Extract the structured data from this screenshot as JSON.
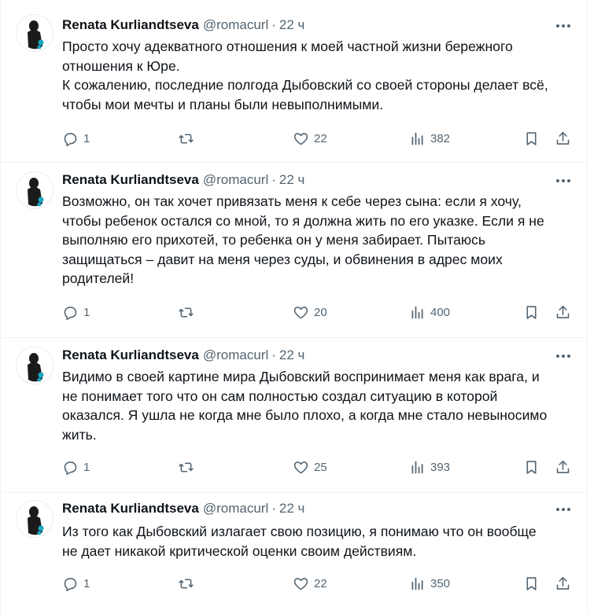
{
  "tweets": [
    {
      "author_name": "Renata Kurliandtseva",
      "handle": "@romacurl",
      "separator": "·",
      "time": "22 ч",
      "lines": [
        "Просто хочу адекватного отношения к моей частной жизни бережного",
        "отношения к Юре.",
        "К сожалению, последние полгода Дыбовский со своей стороны делает всё,",
        "чтобы мои мечты и планы были невыполнимыми."
      ],
      "replies": "1",
      "retweets": "",
      "likes": "22",
      "views": "382"
    },
    {
      "author_name": "Renata Kurliandtseva",
      "handle": "@romacurl",
      "separator": "·",
      "time": "22 ч",
      "lines": [
        "Возможно, он так хочет привязать меня к себе через сына: если я хочу,",
        "чтобы ребенок остался со мной, то я должна жить по его указке. Если я не",
        "выполняю его прихотей, то  ребенка он у меня забирает. Пытаюсь",
        "защищаться – давит на меня через суды, и обвинения в адрес моих",
        "родителей!"
      ],
      "replies": "1",
      "retweets": "",
      "likes": "20",
      "views": "400"
    },
    {
      "author_name": "Renata Kurliandtseva",
      "handle": "@romacurl",
      "separator": "·",
      "time": "22 ч",
      "lines": [
        "Видимо в своей картине мира Дыбовский воспринимает меня как врага, и",
        "не понимает того что он сам полностью создал ситуацию в которой",
        "оказался. Я ушла не когда мне было плохо, а когда мне стало невыносимо",
        "жить."
      ],
      "replies": "1",
      "retweets": "",
      "likes": "25",
      "views": "393"
    },
    {
      "author_name": "Renata Kurliandtseva",
      "handle": "@romacurl",
      "separator": "·",
      "time": "22 ч",
      "lines": [
        "Из того как Дыбовский излагает свою позицию, я понимаю что он вообще",
        "не дает никакой критической оценки своим действиям."
      ],
      "replies": "1",
      "retweets": "",
      "likes": "22",
      "views": "350"
    }
  ],
  "icons": {
    "reply": "reply-icon",
    "retweet": "retweet-icon",
    "like": "heart-icon",
    "views": "views-chart-icon",
    "bookmark": "bookmark-icon",
    "share": "share-icon",
    "more": "more-dots-icon"
  },
  "colors": {
    "text": "#0f1419",
    "secondary": "#536471",
    "border": "#eff3f4",
    "accent_avatar": "#1aa7c2"
  }
}
